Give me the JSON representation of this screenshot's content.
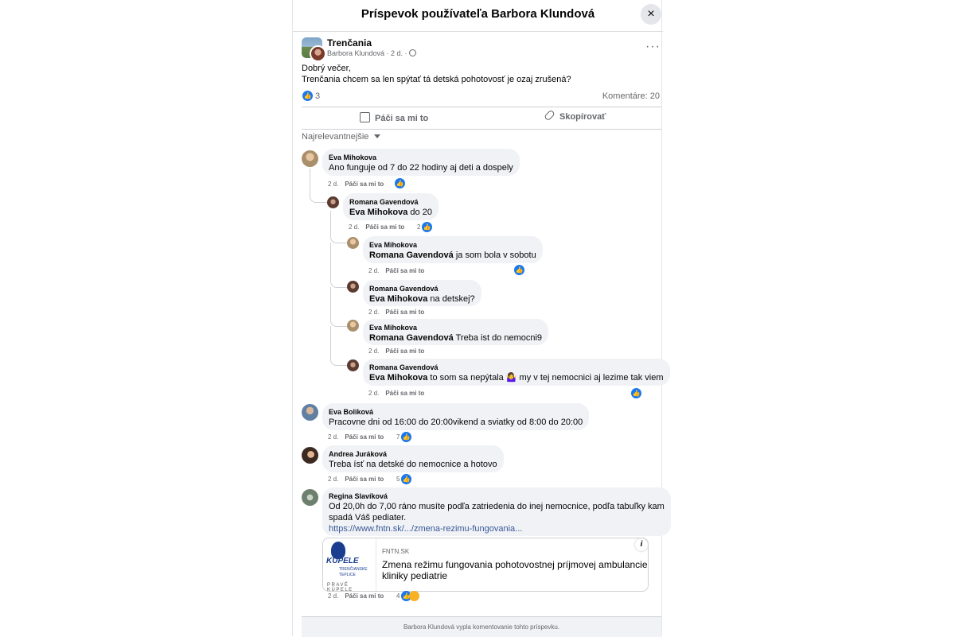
{
  "modal": {
    "title": "Príspevok používateľa Barbora Klundová",
    "close_icon": "×"
  },
  "post": {
    "group_name": "Trenčania",
    "author_time": "Barbora Klundová · 2 d. · ",
    "more_icon": "···",
    "line1": "Dobrý večer,",
    "line2": "Trenčania chcem sa len spýtať tá detská pohotovosť je ozaj zrušená?",
    "like_count": "3",
    "comments_count": "Komentáre: 20",
    "like_button": "Páči sa mi to",
    "copy_button": "Skopírovať"
  },
  "sort_label": "Najrelevantnejšie",
  "comments": [
    {
      "name": "Eva Mihokova",
      "mention": "",
      "text": "Ano funguje od 7 do 22 hodiny aj deti a dospely",
      "time": "2 d.",
      "like": "Páči sa mi to",
      "count": ""
    },
    {
      "name": "Romana Gavendová",
      "mention": "Eva Mihokova",
      "text": " do 20",
      "time": "2 d.",
      "like": "Páči sa mi to",
      "count": "2"
    },
    {
      "name": "Eva Mihokova",
      "mention": "Romana Gavendová",
      "text": " ja som bola v sobotu",
      "time": "2 d.",
      "like": "Páči sa mi to",
      "count": ""
    },
    {
      "name": "Romana Gavendová",
      "mention": "Eva Mihokova",
      "text": " na detskej?",
      "time": "2 d.",
      "like": "Páči sa mi to",
      "count": ""
    },
    {
      "name": "Eva Mihokova",
      "mention": "Romana Gavendová",
      "text": " Treba ist do nemocni9",
      "time": "2 d.",
      "like": "Páči sa mi to",
      "count": ""
    },
    {
      "name": "Romana Gavendová",
      "mention": "Eva Mihokova",
      "text": " to som sa nepýtala 🤷‍♀️ my v tej nemocnici aj lezime tak viem",
      "time": "2 d.",
      "like": "Páči sa mi to",
      "count": ""
    },
    {
      "name": "Eva Boliková",
      "mention": "",
      "text": "Pracovne dni od 16:00 do 20:00vikend a sviatky od 8:00 do 20:00",
      "time": "2 d.",
      "like": "Páči sa mi to",
      "count": "7"
    },
    {
      "name": "Andrea Juráková",
      "mention": "",
      "text": "Treba ísť na detské do nemocnice a hotovo",
      "time": "2 d.",
      "like": "Páči sa mi to",
      "count": "5"
    },
    {
      "name": "Regina Slavíková",
      "mention": "",
      "text": "Od 20,0h do 7,00 ráno musíte podľa zatriedenia do inej nemocnice, podľa tabuľky kam",
      "text2": "spadá Váš pediater.",
      "link": "https://www.fntn.sk/.../zmena-rezimu-fungovania...",
      "time": "2 d.",
      "like": "Páči sa mi to",
      "count": "4"
    }
  ],
  "link_preview": {
    "domain": "FNTN.SK",
    "title1": "Zmena režimu fungovania pohotovostnej príjmovej ambulancie",
    "title2": "kliniky pediatrie",
    "logo_text1": "KÚPELE",
    "logo_text2": "TRENČIANSKE",
    "logo_text3": "TEPLICE",
    "logo_text4": "PRAVÉ KÚPELE",
    "info_icon": "i"
  },
  "footer": "Barbora Klundová vypla komentovanie tohto príspevku.",
  "colors": {
    "accent": "#1877f2",
    "bubble": "#f0f2f5",
    "muted": "#65676b"
  }
}
